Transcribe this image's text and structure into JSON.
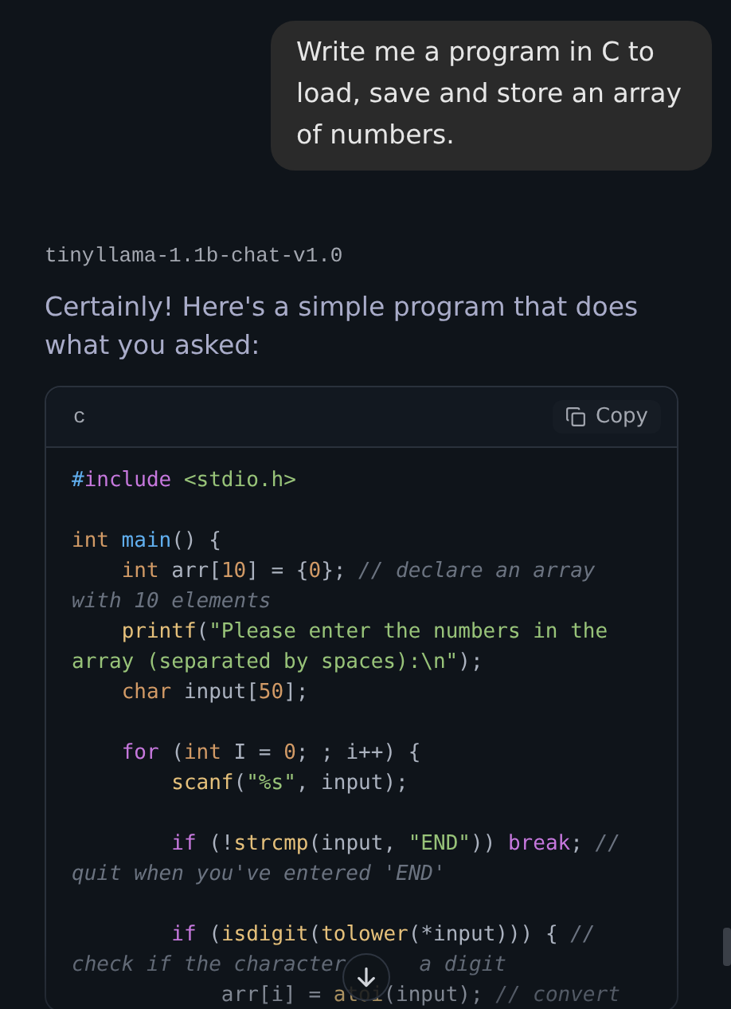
{
  "user_message": "Write me a program in C to load, save and store an array of numbers.",
  "model_name": "tinyllama-1.1b-chat-v1.0",
  "reply_text": "Certainly! Here's a simple program that does what you asked:",
  "code_block": {
    "language": "c",
    "copy_label": "Copy",
    "lines": [
      {
        "kind": "code",
        "tokens": [
          {
            "kind": "hash",
            "text": "#"
          },
          {
            "kind": "keyword",
            "text": "include"
          },
          {
            "kind": "string",
            "text": " <stdio.h>"
          }
        ]
      },
      {
        "kind": "blank"
      },
      {
        "kind": "code",
        "tokens": [
          {
            "kind": "type",
            "text": "int"
          },
          {
            "kind": "func",
            "text": " main"
          },
          {
            "kind": "plain",
            "text": "() {"
          }
        ]
      },
      {
        "kind": "code",
        "tokens": [
          {
            "kind": "type",
            "text": "    int"
          },
          {
            "kind": "plain",
            "text": " arr["
          },
          {
            "kind": "number",
            "text": "10"
          },
          {
            "kind": "plain",
            "text": "] = {"
          },
          {
            "kind": "number",
            "text": "0"
          },
          {
            "kind": "plain",
            "text": "}; "
          },
          {
            "kind": "comment",
            "text": "// declare an array with 10 elements"
          }
        ]
      },
      {
        "kind": "code",
        "tokens": [
          {
            "kind": "builtin",
            "text": "    printf"
          },
          {
            "kind": "plain",
            "text": "("
          },
          {
            "kind": "string",
            "text": "\"Please enter the numbers in the array (separated by spaces):\\n\""
          },
          {
            "kind": "plain",
            "text": ");"
          }
        ]
      },
      {
        "kind": "code",
        "tokens": [
          {
            "kind": "type",
            "text": "    char"
          },
          {
            "kind": "plain",
            "text": " input["
          },
          {
            "kind": "number",
            "text": "50"
          },
          {
            "kind": "plain",
            "text": "];"
          }
        ]
      },
      {
        "kind": "blank"
      },
      {
        "kind": "code",
        "tokens": [
          {
            "kind": "keyword",
            "text": "    for"
          },
          {
            "kind": "plain",
            "text": " ("
          },
          {
            "kind": "type",
            "text": "int"
          },
          {
            "kind": "plain",
            "text": " I = "
          },
          {
            "kind": "number",
            "text": "0"
          },
          {
            "kind": "plain",
            "text": "; ; i++) {"
          }
        ]
      },
      {
        "kind": "code",
        "tokens": [
          {
            "kind": "builtin",
            "text": "        scanf"
          },
          {
            "kind": "plain",
            "text": "("
          },
          {
            "kind": "string",
            "text": "\"%s\""
          },
          {
            "kind": "plain",
            "text": ", input);"
          }
        ]
      },
      {
        "kind": "blank"
      },
      {
        "kind": "code",
        "tokens": [
          {
            "kind": "keyword",
            "text": "        if"
          },
          {
            "kind": "plain",
            "text": " (!"
          },
          {
            "kind": "builtin",
            "text": "strcmp"
          },
          {
            "kind": "plain",
            "text": "(input, "
          },
          {
            "kind": "string",
            "text": "\"END\""
          },
          {
            "kind": "plain",
            "text": ")) "
          },
          {
            "kind": "keyword",
            "text": "break"
          },
          {
            "kind": "plain",
            "text": "; "
          },
          {
            "kind": "comment",
            "text": "// quit when you've entered 'END'"
          }
        ]
      },
      {
        "kind": "blank"
      },
      {
        "kind": "code",
        "tokens": [
          {
            "kind": "keyword",
            "text": "        if"
          },
          {
            "kind": "plain",
            "text": " ("
          },
          {
            "kind": "builtin",
            "text": "isdigit"
          },
          {
            "kind": "plain",
            "text": "("
          },
          {
            "kind": "builtin",
            "text": "tolower"
          },
          {
            "kind": "plain",
            "text": "(*input))) { "
          },
          {
            "kind": "comment",
            "text": "//"
          }
        ]
      },
      {
        "kind": "split",
        "parts": [
          "check if the character",
          "a digit"
        ]
      },
      {
        "kind": "code",
        "tokens": [
          {
            "kind": "plain",
            "text": "            arr[i] = "
          },
          {
            "kind": "builtin",
            "text": "atoi"
          },
          {
            "kind": "plain",
            "text": "(input); "
          },
          {
            "kind": "comment",
            "text": "// convert"
          }
        ]
      }
    ]
  }
}
